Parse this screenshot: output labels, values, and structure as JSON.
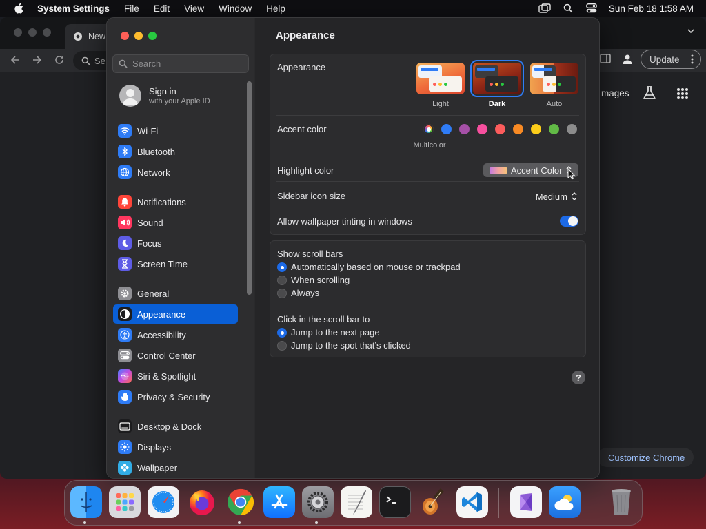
{
  "menubar": {
    "app_name": "System Settings",
    "items": [
      "File",
      "Edit",
      "View",
      "Window",
      "Help"
    ],
    "clock": "Sun Feb 18  1:58 AM"
  },
  "chrome": {
    "tab_title": "New",
    "omnibox_partial": "Se",
    "update_label": "Update",
    "images_label": "mages",
    "customize_label": "Customize Chrome"
  },
  "settings": {
    "search_placeholder": "Search",
    "signin": {
      "title": "Sign in",
      "subtitle": "with your Apple ID"
    },
    "sidebar_items": [
      {
        "label": "Wi-Fi",
        "icon": "wifi-icon",
        "color": "#2f7cf6"
      },
      {
        "label": "Bluetooth",
        "icon": "bluetooth-icon",
        "color": "#2f7cf6"
      },
      {
        "label": "Network",
        "icon": "globe-icon",
        "color": "#2f7cf6"
      },
      {
        "label": "Notifications",
        "icon": "bell-icon",
        "color": "#ff453a"
      },
      {
        "label": "Sound",
        "icon": "speaker-icon",
        "color": "#ff375f"
      },
      {
        "label": "Focus",
        "icon": "moon-icon",
        "color": "#5e5ce6"
      },
      {
        "label": "Screen Time",
        "icon": "hourglass-icon",
        "color": "#5e5ce6"
      },
      {
        "label": "General",
        "icon": "gear-icon",
        "color": "#8e8e93"
      },
      {
        "label": "Appearance",
        "icon": "appearance-icon",
        "color": "#1c1c1e"
      },
      {
        "label": "Accessibility",
        "icon": "accessibility-icon",
        "color": "#2f7cf6"
      },
      {
        "label": "Control Center",
        "icon": "control-center-icon",
        "color": "#8e8e93"
      },
      {
        "label": "Siri & Spotlight",
        "icon": "siri-icon",
        "color": "#af52de"
      },
      {
        "label": "Privacy & Security",
        "icon": "hand-icon",
        "color": "#2f7cf6"
      },
      {
        "label": "Desktop & Dock",
        "icon": "dock-icon",
        "color": "#1c1c1e"
      },
      {
        "label": "Displays",
        "icon": "sun-icon",
        "color": "#2f7cf6"
      },
      {
        "label": "Wallpaper",
        "icon": "wallpaper-icon",
        "color": "#32ade6"
      }
    ],
    "selected_item": "Appearance",
    "page_title": "Appearance",
    "appearance": {
      "label": "Appearance",
      "options": [
        "Light",
        "Dark",
        "Auto"
      ],
      "selected": "Dark"
    },
    "accent": {
      "label": "Accent color",
      "colors": [
        "multicolor",
        "#2f7cf6",
        "#a550a7",
        "#f74f9e",
        "#fc5c5c",
        "#f88a24",
        "#fccd1a",
        "#62ba46",
        "#8c8c8c"
      ],
      "selected_caption": "Multicolor"
    },
    "highlight": {
      "label": "Highlight color",
      "value": "Accent Color"
    },
    "sidebar_icon_size": {
      "label": "Sidebar icon size",
      "value": "Medium"
    },
    "wallpaper_tinting": {
      "label": "Allow wallpaper tinting in windows",
      "enabled": true
    },
    "scroll_bars": {
      "label": "Show scroll bars",
      "options": [
        "Automatically based on mouse or trackpad",
        "When scrolling",
        "Always"
      ],
      "selected": "Automatically based on mouse or trackpad"
    },
    "click_scroll": {
      "label": "Click in the scroll bar to",
      "options": [
        "Jump to the next page",
        "Jump to the spot that’s clicked"
      ],
      "selected": "Jump to the next page"
    },
    "help_label": "?"
  },
  "dock": {
    "apps": [
      "Finder",
      "Launchpad",
      "Safari",
      "Firefox",
      "Chrome",
      "App Store",
      "System Settings",
      "TextEdit",
      "Terminal",
      "GarageBand",
      "Visual Studio Code",
      "Visual Studio",
      "Weather",
      "Trash"
    ]
  }
}
